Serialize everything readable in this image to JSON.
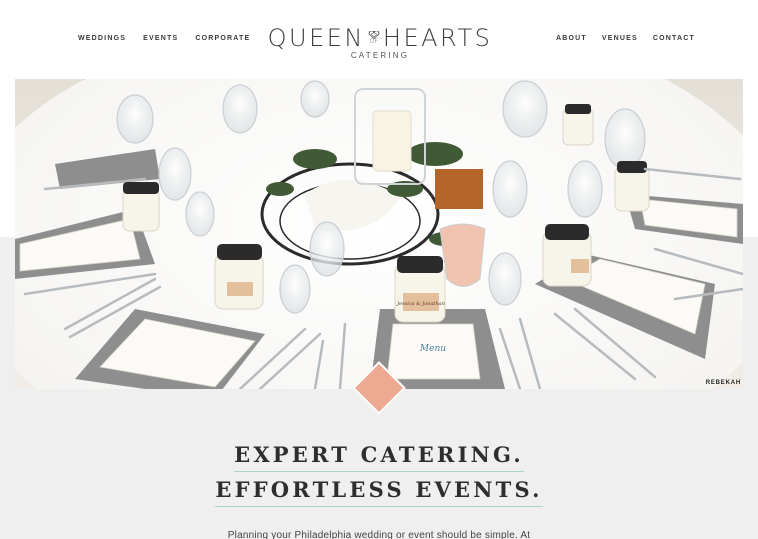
{
  "nav": {
    "left": [
      "WEDDINGS",
      "EVENTS",
      "CORPORATE"
    ],
    "right": [
      "ABOUT",
      "VENUES",
      "CONTACT"
    ]
  },
  "logo": {
    "word1": "QUEEN",
    "of": "OF",
    "word2": "HEARTS",
    "sub": "CATERING"
  },
  "hero": {
    "photo_credit": "REBEKAH",
    "jar_label": "Jessica & Jonathan",
    "menu_title": "Menu"
  },
  "headline": {
    "line1": "EXPERT CATERING.",
    "line2": "EFFORTLESS EVENTS."
  },
  "intro": "Planning your Philadelphia wedding or event should be simple. At",
  "colors": {
    "accent_diamond": "#ecab90",
    "underline": "#a9d3cc",
    "band": "#efefef"
  }
}
